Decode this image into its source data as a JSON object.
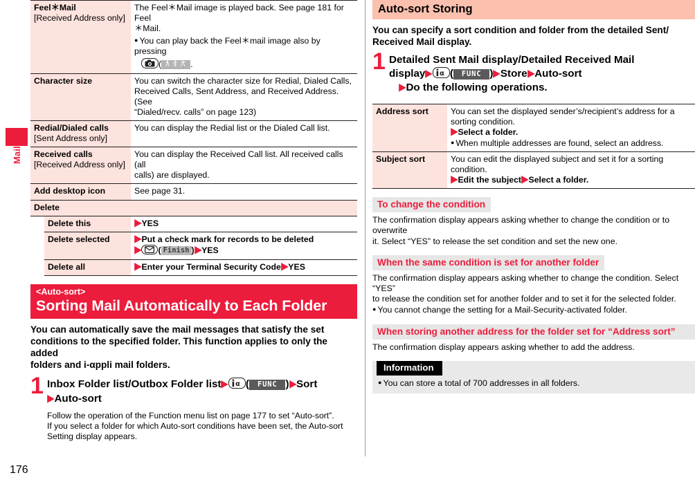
{
  "page": {
    "number": "176",
    "side_tab_label": "Mail"
  },
  "left_column": {
    "function_table": {
      "rows": [
        {
          "key": "Feel＊Mail",
          "key_sub": "[Received Address only]",
          "value_lines": [
            "The Feel＊Mail image is played back. See page 181 for Feel",
            "＊Mail."
          ],
          "bullet": {
            "prefix": "You can play back the Feel＊mail image also by pressing",
            "key_icon": "camera-key-icon",
            "softkey_label": "dance-icon",
            "suffix": "."
          }
        },
        {
          "key": "Character size",
          "key_sub": "",
          "value_lines": [
            "You can switch the character size for Redial, Dialed Calls,",
            "Received Calls, Sent Address, and Received Address. (See",
            "“Dialed/recv. calls” on page 123)"
          ]
        },
        {
          "key": "Redial/Dialed calls",
          "key_sub": "[Sent Address only]",
          "value_lines": [
            "You can display the Redial list or the Dialed Call list."
          ]
        },
        {
          "key": "Received calls",
          "key_sub": "[Received Address only]",
          "value_lines": [
            "You can display the Received Call list. All received calls (all",
            "calls) are displayed."
          ]
        },
        {
          "key": "Add desktop icon",
          "key_sub": "",
          "value_lines": [
            "See page 31."
          ]
        }
      ],
      "delete_group": {
        "label": "Delete",
        "rows": [
          {
            "key": "Delete this",
            "value_parts": [
              {
                "type": "tri"
              },
              {
                "type": "text",
                "text": "YES"
              }
            ]
          },
          {
            "key": "Delete selected",
            "value_parts": [
              {
                "type": "tri"
              },
              {
                "type": "text",
                "text": "Put a check mark for records to be deleted"
              },
              {
                "type": "break"
              },
              {
                "type": "tri"
              },
              {
                "type": "key",
                "icon": "mail-key-icon"
              },
              {
                "type": "text",
                "text": "("
              },
              {
                "type": "softkey",
                "label": "Finish"
              },
              {
                "type": "text",
                "text": ")"
              },
              {
                "type": "tri"
              },
              {
                "type": "text",
                "text": "YES"
              }
            ]
          },
          {
            "key": "Delete all",
            "value_parts": [
              {
                "type": "tri"
              },
              {
                "type": "text",
                "text": "Enter your Terminal Security Code"
              },
              {
                "type": "tri"
              },
              {
                "type": "text",
                "text": "YES"
              }
            ]
          }
        ]
      }
    },
    "banner": {
      "eyebrow": "<Auto-sort>",
      "title": "Sorting Mail Automatically to Each Folder"
    },
    "intro_lines": [
      "You can automatically save the mail messages that satisfy the set",
      "conditions to the specified folder. This function applies to only the added",
      "folders and i-αppli mail folders."
    ],
    "step": {
      "number": "1",
      "line1_a": "Inbox Folder list/Outbox Folder list",
      "line1_softkey": "FUNC",
      "line1_b": "Sort",
      "line2": "Auto-sort",
      "note_lines": [
        "Follow the operation of the Function menu list on page 177 to set “Auto-sort”.",
        "If you select a folder for which Auto-sort conditions have been set, the Auto-sort",
        "Setting display appears."
      ]
    }
  },
  "right_column": {
    "section_title": "Auto-sort Storing",
    "section_intro_lines": [
      "You can specify a sort condition and folder from the detailed Sent/",
      "Received Mail display."
    ],
    "step": {
      "number": "1",
      "line1": "Detailed Sent Mail display/Detailed Received Mail",
      "line2_a": "display",
      "line2_softkey": "FUNC",
      "line2_b": "Store",
      "line2_c": "Auto-sort",
      "line3": "Do the following operations."
    },
    "sort_table": {
      "rows": [
        {
          "key": "Address sort",
          "lines": [
            "You can set the displayed sender’s/recipient’s address for a",
            "sorting condition."
          ],
          "action": "Select a folder.",
          "bullet": "When multiple addresses are found, select an address."
        },
        {
          "key": "Subject sort",
          "lines": [
            "You can edit the displayed subject and set it for a sorting",
            "condition."
          ],
          "action_a": "Edit the subject",
          "action_b": "Select a folder."
        }
      ]
    },
    "subsections": [
      {
        "heading": "To change the condition",
        "lines": [
          "The confirmation display appears asking whether to change the condition or to overwrite",
          "it. Select “YES” to release the set condition and set the new one."
        ],
        "bullets": []
      },
      {
        "heading": "When the same condition is set for another folder",
        "lines": [
          "The confirmation display appears asking whether to change the condition. Select “YES”",
          "to release the condition set for another folder and to set it for the selected folder."
        ],
        "bullets": [
          "You cannot change the setting for a Mail-Security-activated folder."
        ]
      },
      {
        "heading": "When storing another address for the folder set for “Address sort”",
        "lines": [
          "The confirmation display appears asking whether to add the address."
        ],
        "bullets": []
      }
    ],
    "information": {
      "tag": "Information",
      "bullets": [
        "You can store a total of 700 addresses in all folders."
      ]
    }
  },
  "colors": {
    "accent_red": "#ec1c3c",
    "table_key_bg": "#fde3dd",
    "pink_head_bg": "#fbc0ae",
    "gray_head_bg": "#e6e6e6",
    "info_bg": "#e9e9e9"
  }
}
